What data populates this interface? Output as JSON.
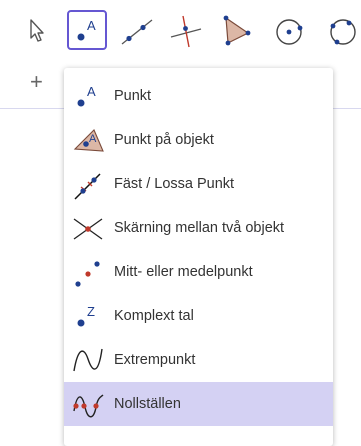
{
  "toolbar": {
    "tools": [
      {
        "icon": "cursor-icon"
      },
      {
        "icon": "point-icon",
        "label": "A",
        "selected": true
      },
      {
        "icon": "line-icon"
      },
      {
        "icon": "perpendicular-line-icon"
      },
      {
        "icon": "polygon-icon"
      },
      {
        "icon": "circle-center-point-icon"
      },
      {
        "icon": "circle-three-points-icon"
      }
    ],
    "accent": "#6557d2"
  },
  "algebra": {
    "add_symbol": "+"
  },
  "menu": {
    "items": [
      {
        "label": "Punkt",
        "icon": "point-icon",
        "icon_text": "A"
      },
      {
        "label": "Punkt på objekt",
        "icon": "point-on-object-icon",
        "icon_text": "A"
      },
      {
        "label": "Fäst / Lossa Punkt",
        "icon": "attach-detach-point-icon"
      },
      {
        "label": "Skärning mellan två objekt",
        "icon": "intersect-icon"
      },
      {
        "label": "Mitt- eller medelpunkt",
        "icon": "midpoint-icon"
      },
      {
        "label": "Komplext tal",
        "icon": "complex-number-icon",
        "icon_text": "Z"
      },
      {
        "label": "Extrempunkt",
        "icon": "extremum-icon"
      },
      {
        "label": "Nollställen",
        "icon": "roots-icon",
        "active": true
      }
    ],
    "highlight_color": "#d4d1f3"
  }
}
